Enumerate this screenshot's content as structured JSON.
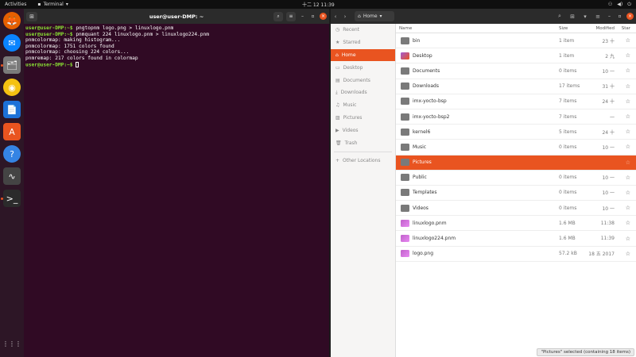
{
  "topbar": {
    "activities": "Activities",
    "app_name": "Terminal",
    "clock": "十二 12  11:39"
  },
  "dock": {
    "items": [
      {
        "name": "firefox-icon",
        "glyph": "🦊"
      },
      {
        "name": "thunderbird-icon",
        "glyph": "✉"
      },
      {
        "name": "files-icon",
        "glyph": "🗂"
      },
      {
        "name": "rhythmbox-icon",
        "glyph": "◉"
      },
      {
        "name": "writer-icon",
        "glyph": "📄"
      },
      {
        "name": "software-icon",
        "glyph": "A"
      },
      {
        "name": "help-icon",
        "glyph": "?"
      },
      {
        "name": "monitor-icon",
        "glyph": "∿"
      },
      {
        "name": "terminal-icon",
        "glyph": ">_"
      }
    ],
    "apps_grid": "⋮⋮⋮"
  },
  "terminal": {
    "title": "user@user-DMP: ~",
    "lines": [
      {
        "prompt": "user@user-DMP:~$",
        "text": " pngtopnm logo.png > linuxlogo.pnm"
      },
      {
        "prompt": "user@user-DMP:~$",
        "text": " pnmquant 224 linuxlogo.pnm > linuxlogo224.pnm"
      },
      {
        "prompt": "",
        "text": "pnmcolormap: making histogram..."
      },
      {
        "prompt": "",
        "text": "pnmcolormap: 1751 colors found"
      },
      {
        "prompt": "",
        "text": "pnmcolormap: choosing 224 colors..."
      },
      {
        "prompt": "",
        "text": "pnmremap: 217 colors found in colormap"
      },
      {
        "prompt": "user@user-DMP:~$",
        "text": " "
      }
    ]
  },
  "files": {
    "path": "Home",
    "columns": {
      "name": "Name",
      "size": "Size",
      "modified": "Modified",
      "star": "Star"
    },
    "sidebar": [
      {
        "label": "Recent",
        "icon": "◷",
        "active": false
      },
      {
        "label": "Starred",
        "icon": "★",
        "active": false
      },
      {
        "label": "Home",
        "icon": "⌂",
        "active": true
      },
      {
        "label": "Desktop",
        "icon": "▭",
        "active": false
      },
      {
        "label": "Documents",
        "icon": "▤",
        "active": false
      },
      {
        "label": "Downloads",
        "icon": "⤓",
        "active": false
      },
      {
        "label": "Music",
        "icon": "♫",
        "active": false
      },
      {
        "label": "Pictures",
        "icon": "▨",
        "active": false
      },
      {
        "label": "Videos",
        "icon": "▶",
        "active": false
      },
      {
        "label": "Trash",
        "icon": "🗑",
        "active": false
      },
      {
        "label": "Other Locations",
        "icon": "+",
        "active": false
      }
    ],
    "rows": [
      {
        "name": "bin",
        "size": "1 item",
        "modified": "23 十",
        "type": "folder"
      },
      {
        "name": "Desktop",
        "size": "1 item",
        "modified": "2 九",
        "type": "desk"
      },
      {
        "name": "Documents",
        "size": "0 items",
        "modified": "10 一",
        "type": "folder"
      },
      {
        "name": "Downloads",
        "size": "17 items",
        "modified": "31 十",
        "type": "folder"
      },
      {
        "name": "imx-yocto-bsp",
        "size": "7 items",
        "modified": "24 十",
        "type": "folder"
      },
      {
        "name": "imx-yocto-bsp2",
        "size": "7 items",
        "modified": "一",
        "type": "folder"
      },
      {
        "name": "kernel6",
        "size": "5 items",
        "modified": "24 十",
        "type": "folder"
      },
      {
        "name": "Music",
        "size": "0 items",
        "modified": "10 一",
        "type": "folder"
      },
      {
        "name": "Pictures",
        "size": "",
        "modified": "",
        "type": "folder",
        "selected": true
      },
      {
        "name": "Public",
        "size": "0 items",
        "modified": "10 一",
        "type": "folder"
      },
      {
        "name": "Templates",
        "size": "0 items",
        "modified": "10 一",
        "type": "folder"
      },
      {
        "name": "Videos",
        "size": "0 items",
        "modified": "10 一",
        "type": "folder"
      },
      {
        "name": "linuxlogo.pnm",
        "size": "1.6 MB",
        "modified": "11:38",
        "type": "img"
      },
      {
        "name": "linuxlogo224.pnm",
        "size": "1.6 MB",
        "modified": "11:39",
        "type": "img"
      },
      {
        "name": "logo.png",
        "size": "57.2 kB",
        "modified": "18 五 2017",
        "type": "img"
      }
    ],
    "status": "\"Pictures\" selected  (containing 18 items)"
  }
}
